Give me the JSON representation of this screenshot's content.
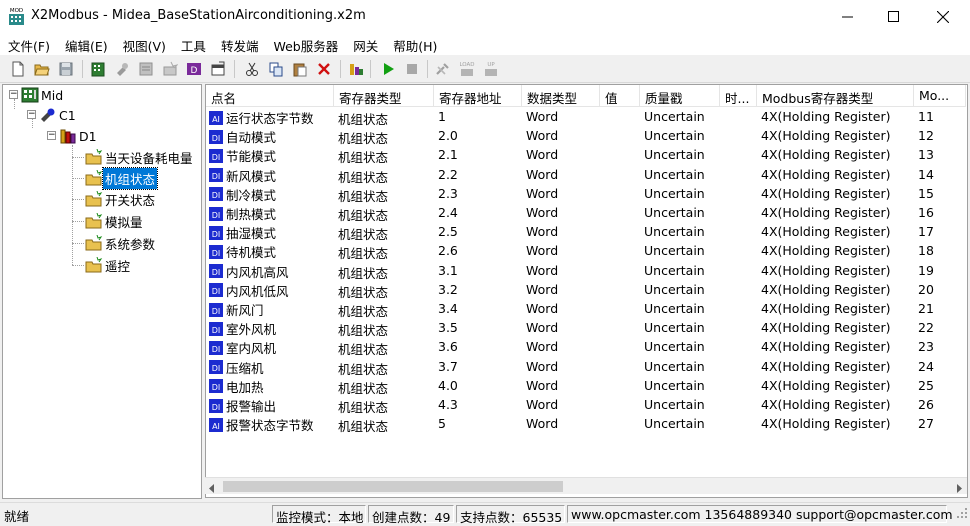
{
  "window": {
    "app_icon_text": "MOD",
    "title": "X2Modbus - Midea_BaseStationAirconditioning.x2m"
  },
  "menu": [
    {
      "label": "文件(F)"
    },
    {
      "label": "编辑(E)"
    },
    {
      "label": "视图(V)"
    },
    {
      "label": "工具"
    },
    {
      "label": "转发端"
    },
    {
      "label": "Web服务器"
    },
    {
      "label": "网关"
    },
    {
      "label": "帮助(H)"
    }
  ],
  "toolbar": {
    "icons": [
      "new-file-icon",
      "open-folder-icon",
      "save-icon",
      "add-channel-icon",
      "add-device-icon",
      "add-group-icon",
      "add-tag-icon",
      "add-tag-dt-icon",
      "properties-icon",
      "cut-icon",
      "copy-icon",
      "paste-icon",
      "delete-icon",
      "monitor-icon",
      "run-icon",
      "stop-icon",
      "tools-icon",
      "load-icon",
      "up-icon"
    ],
    "load_text": "LOAD",
    "up_text": "UP"
  },
  "tree": {
    "root": "Mid",
    "channel": "C1",
    "device": "D1",
    "groups": [
      "当天设备耗电量",
      "机组状态",
      "开关状态",
      "模拟量",
      "系统参数",
      "遥控"
    ],
    "selected_index": 1
  },
  "table": {
    "columns": [
      "点名",
      "寄存器类型",
      "寄存器地址",
      "数据类型",
      "值",
      "质量戳",
      "时...",
      "Modbus寄存器类型",
      "Mo..."
    ],
    "rows": [
      {
        "icon": "AI",
        "name": "运行状态字节数",
        "reg_type": "机组状态",
        "reg_addr": "1",
        "data_type": "Word",
        "value": "",
        "quality": "Uncertain",
        "time": "",
        "modbus_type": "4X(Holding Register)",
        "mo": "11"
      },
      {
        "icon": "DI",
        "name": "自动模式",
        "reg_type": "机组状态",
        "reg_addr": "2.0",
        "data_type": "Word",
        "value": "",
        "quality": "Uncertain",
        "time": "",
        "modbus_type": "4X(Holding Register)",
        "mo": "12"
      },
      {
        "icon": "DI",
        "name": "节能模式",
        "reg_type": "机组状态",
        "reg_addr": "2.1",
        "data_type": "Word",
        "value": "",
        "quality": "Uncertain",
        "time": "",
        "modbus_type": "4X(Holding Register)",
        "mo": "13"
      },
      {
        "icon": "DI",
        "name": "新风模式",
        "reg_type": "机组状态",
        "reg_addr": "2.2",
        "data_type": "Word",
        "value": "",
        "quality": "Uncertain",
        "time": "",
        "modbus_type": "4X(Holding Register)",
        "mo": "14"
      },
      {
        "icon": "DI",
        "name": "制冷模式",
        "reg_type": "机组状态",
        "reg_addr": "2.3",
        "data_type": "Word",
        "value": "",
        "quality": "Uncertain",
        "time": "",
        "modbus_type": "4X(Holding Register)",
        "mo": "15"
      },
      {
        "icon": "DI",
        "name": "制热模式",
        "reg_type": "机组状态",
        "reg_addr": "2.4",
        "data_type": "Word",
        "value": "",
        "quality": "Uncertain",
        "time": "",
        "modbus_type": "4X(Holding Register)",
        "mo": "16"
      },
      {
        "icon": "DI",
        "name": "抽湿模式",
        "reg_type": "机组状态",
        "reg_addr": "2.5",
        "data_type": "Word",
        "value": "",
        "quality": "Uncertain",
        "time": "",
        "modbus_type": "4X(Holding Register)",
        "mo": "17"
      },
      {
        "icon": "DI",
        "name": "待机模式",
        "reg_type": "机组状态",
        "reg_addr": "2.6",
        "data_type": "Word",
        "value": "",
        "quality": "Uncertain",
        "time": "",
        "modbus_type": "4X(Holding Register)",
        "mo": "18"
      },
      {
        "icon": "DI",
        "name": "内风机高风",
        "reg_type": "机组状态",
        "reg_addr": "3.1",
        "data_type": "Word",
        "value": "",
        "quality": "Uncertain",
        "time": "",
        "modbus_type": "4X(Holding Register)",
        "mo": "19"
      },
      {
        "icon": "DI",
        "name": "内风机低风",
        "reg_type": "机组状态",
        "reg_addr": "3.2",
        "data_type": "Word",
        "value": "",
        "quality": "Uncertain",
        "time": "",
        "modbus_type": "4X(Holding Register)",
        "mo": "20"
      },
      {
        "icon": "DI",
        "name": "新风门",
        "reg_type": "机组状态",
        "reg_addr": "3.4",
        "data_type": "Word",
        "value": "",
        "quality": "Uncertain",
        "time": "",
        "modbus_type": "4X(Holding Register)",
        "mo": "21"
      },
      {
        "icon": "DI",
        "name": "室外风机",
        "reg_type": "机组状态",
        "reg_addr": "3.5",
        "data_type": "Word",
        "value": "",
        "quality": "Uncertain",
        "time": "",
        "modbus_type": "4X(Holding Register)",
        "mo": "22"
      },
      {
        "icon": "DI",
        "name": "室内风机",
        "reg_type": "机组状态",
        "reg_addr": "3.6",
        "data_type": "Word",
        "value": "",
        "quality": "Uncertain",
        "time": "",
        "modbus_type": "4X(Holding Register)",
        "mo": "23"
      },
      {
        "icon": "DI",
        "name": "压缩机",
        "reg_type": "机组状态",
        "reg_addr": "3.7",
        "data_type": "Word",
        "value": "",
        "quality": "Uncertain",
        "time": "",
        "modbus_type": "4X(Holding Register)",
        "mo": "24"
      },
      {
        "icon": "DI",
        "name": "电加热",
        "reg_type": "机组状态",
        "reg_addr": "4.0",
        "data_type": "Word",
        "value": "",
        "quality": "Uncertain",
        "time": "",
        "modbus_type": "4X(Holding Register)",
        "mo": "25"
      },
      {
        "icon": "DI",
        "name": "报警输出",
        "reg_type": "机组状态",
        "reg_addr": "4.3",
        "data_type": "Word",
        "value": "",
        "quality": "Uncertain",
        "time": "",
        "modbus_type": "4X(Holding Register)",
        "mo": "26"
      },
      {
        "icon": "AI",
        "name": "报警状态字节数",
        "reg_type": "机组状态",
        "reg_addr": "5",
        "data_type": "Word",
        "value": "",
        "quality": "Uncertain",
        "time": "",
        "modbus_type": "4X(Holding Register)",
        "mo": "27"
      }
    ]
  },
  "status": {
    "ready": "就绪",
    "monitor_mode": "监控模式：本地",
    "created_points": "创建点数：49",
    "supported_points": "支持点数：65535",
    "contact": "www.opcmaster.com 13564889340 support@opcmaster.com"
  },
  "colors": {
    "selection": "#0078d7",
    "icon_blue": "#1c2bd0",
    "run_green": "#12a012",
    "delete_red": "#d01010"
  }
}
